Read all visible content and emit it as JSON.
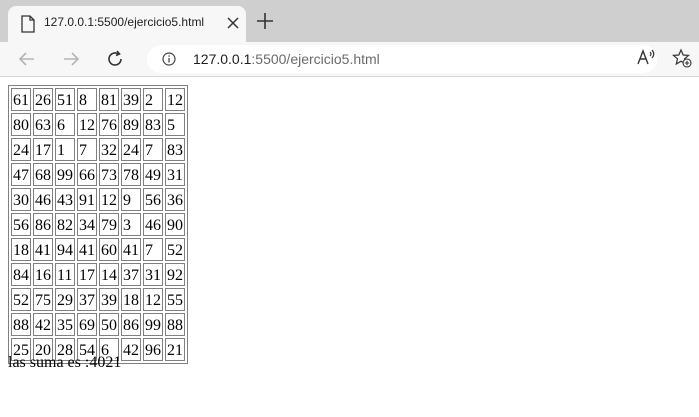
{
  "browser": {
    "tab": {
      "title": "127.0.0.1:5500/ejercicio5.html",
      "close_icon": "close-icon"
    },
    "new_tab_icon": "plus-icon",
    "address_bar": {
      "host": "127.0.0.1",
      "path": ":5500/ejercicio5.html",
      "info_icon": "info-icon"
    },
    "toolbar_icons": [
      "back-arrow-icon",
      "forward-arrow-icon",
      "reload-icon",
      "read-aloud-icon",
      "add-favorite-icon"
    ]
  },
  "page": {
    "table": [
      [
        61,
        26,
        51,
        8,
        81,
        39,
        2,
        12
      ],
      [
        80,
        63,
        6,
        12,
        76,
        89,
        83,
        5
      ],
      [
        24,
        17,
        1,
        7,
        32,
        24,
        7,
        83
      ],
      [
        47,
        68,
        99,
        66,
        73,
        78,
        49,
        31
      ],
      [
        30,
        46,
        43,
        91,
        12,
        9,
        56,
        36
      ],
      [
        56,
        86,
        82,
        34,
        79,
        3,
        46,
        90
      ],
      [
        18,
        41,
        94,
        41,
        60,
        41,
        7,
        52
      ],
      [
        84,
        16,
        11,
        17,
        14,
        37,
        31,
        92
      ],
      [
        52,
        75,
        29,
        37,
        39,
        18,
        12,
        55
      ],
      [
        88,
        42,
        35,
        69,
        50,
        86,
        99,
        88
      ],
      [
        25,
        20,
        28,
        54,
        6,
        42,
        96,
        21
      ]
    ],
    "sum_text": "las suma es :4021"
  },
  "colors": {
    "tab_strip": "#cfcfcf",
    "toolbar": "#f7f7f7",
    "url_path": "#6b6b6b"
  }
}
